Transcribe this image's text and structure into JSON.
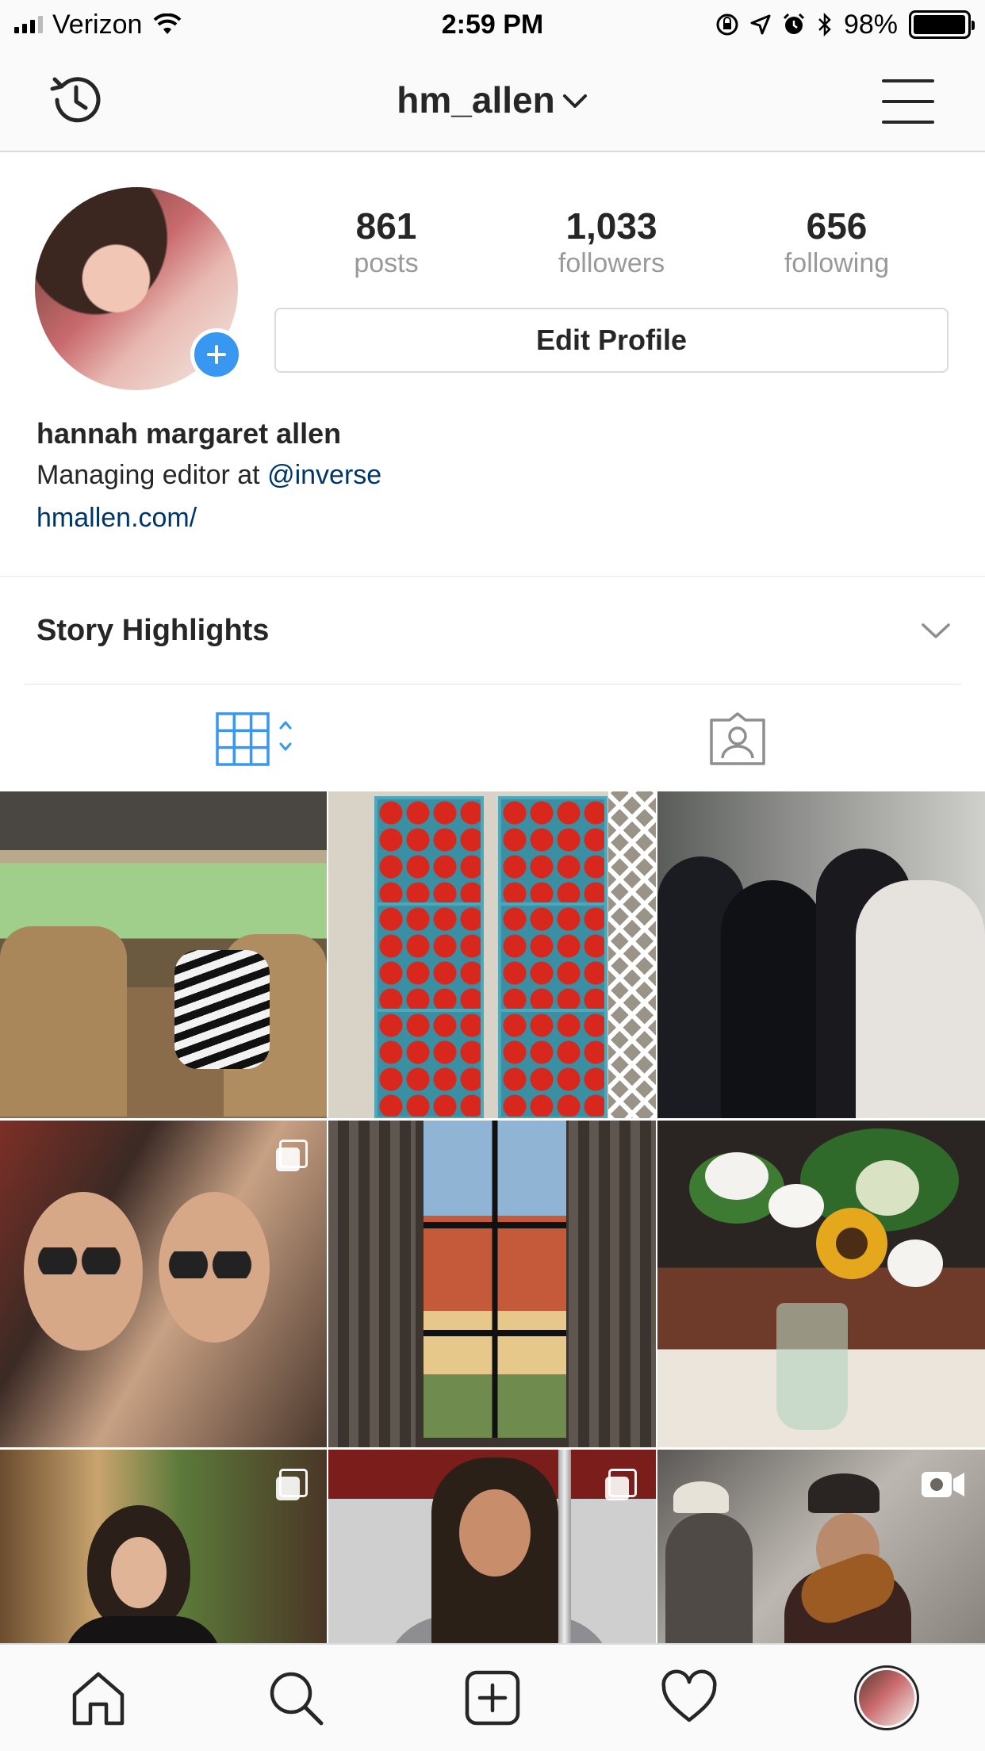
{
  "status_bar": {
    "carrier": "Verizon",
    "time": "2:59 PM",
    "battery_pct": "98%",
    "battery_level": 0.98,
    "icons": [
      "signal-icon",
      "wifi-icon",
      "orientation-lock-icon",
      "location-icon",
      "alarm-icon",
      "bluetooth-icon",
      "battery-icon"
    ]
  },
  "header": {
    "username": "hm_allen",
    "left_icon": "history-icon",
    "right_icon": "menu-icon"
  },
  "profile": {
    "stats": [
      {
        "value": "861",
        "label": "posts"
      },
      {
        "value": "1,033",
        "label": "followers"
      },
      {
        "value": "656",
        "label": "following"
      }
    ],
    "edit_button": "Edit Profile",
    "name": "hannah margaret allen",
    "bio_prefix": "Managing editor at ",
    "bio_mention": "@inverse",
    "website": "hmallen.com/"
  },
  "highlights": {
    "title": "Story Highlights"
  },
  "tabs": [
    {
      "name": "grid-view",
      "icon": "grid-icon",
      "active": true
    },
    {
      "name": "tagged",
      "icon": "tagged-photos-icon",
      "active": false
    }
  ],
  "grid": {
    "posts": [
      {
        "subject": "car-interior",
        "badge": null
      },
      {
        "subject": "tomatoes",
        "badge": null
      },
      {
        "subject": "bridal-party",
        "badge": null
      },
      {
        "subject": "selfie-sunglasses",
        "badge": "multiple-photos-icon"
      },
      {
        "subject": "window-view",
        "badge": null
      },
      {
        "subject": "flower-vase",
        "badge": null
      },
      {
        "subject": "woman-portrait",
        "badge": "multiple-photos-icon"
      },
      {
        "subject": "girl-smiling",
        "badge": "multiple-photos-icon"
      },
      {
        "subject": "band-performance",
        "badge": "video-icon"
      }
    ]
  },
  "bottom_nav": [
    {
      "name": "home",
      "icon": "home-icon"
    },
    {
      "name": "search",
      "icon": "search-icon"
    },
    {
      "name": "new-post",
      "icon": "add-post-icon"
    },
    {
      "name": "activity",
      "icon": "heart-icon"
    },
    {
      "name": "profile",
      "icon": "profile-avatar"
    }
  ],
  "colors": {
    "accent": "#3897f0",
    "link": "#003569",
    "text": "#262626",
    "muted": "#999999",
    "border": "#dbdbdb"
  }
}
